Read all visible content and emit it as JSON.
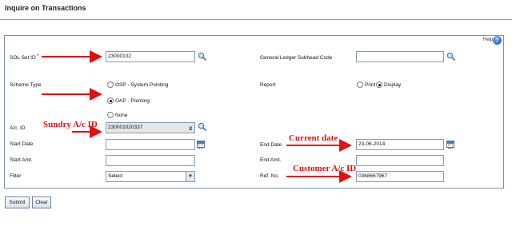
{
  "page": {
    "title": "Inquire on Transactions"
  },
  "help": {
    "label": "Help",
    "icon": "help-icon",
    "glyph": "?"
  },
  "form": {
    "sol_set_id": {
      "label": "SOL Set ID",
      "required_mark": "*",
      "value": "23000102"
    },
    "gl_subhead_code": {
      "label": "General Ledger Subhead Code",
      "value": ""
    },
    "scheme_type": {
      "label": "Scheme Type",
      "options": [
        {
          "label": "OSP - System Pointing",
          "selected": false
        },
        {
          "label": "OAP - Pointing",
          "selected": true
        },
        {
          "label": "None",
          "selected": false
        }
      ]
    },
    "report": {
      "label": "Report",
      "options": [
        {
          "label": "Print",
          "selected": false
        },
        {
          "label": "Display",
          "selected": true
        }
      ]
    },
    "ac_id": {
      "label": "A/c. ID",
      "value": "230001020337",
      "clear_glyph": "x"
    },
    "start_date": {
      "label": "Start Date",
      "value": ""
    },
    "end_date": {
      "label": "End Date",
      "value": "23-06-2014"
    },
    "start_amt": {
      "label": "Start Amt.",
      "value": ""
    },
    "end_amt": {
      "label": "End Amt.",
      "value": ""
    },
    "filter": {
      "label": "Filter",
      "selected": "Select",
      "arrow_glyph": "▼"
    },
    "ref_no": {
      "label": "Ref. No.",
      "value": "0368667967"
    }
  },
  "buttons": {
    "submit": "Submit",
    "clear": "Clear"
  },
  "annotations": {
    "sundry": "Sundry A/c ID",
    "current_date": "Current date",
    "customer": "Customer A/c ID"
  },
  "colors": {
    "annotation_red": "#dd1111",
    "field_border": "#7f9db9",
    "panel_border": "#7f8fb0"
  }
}
